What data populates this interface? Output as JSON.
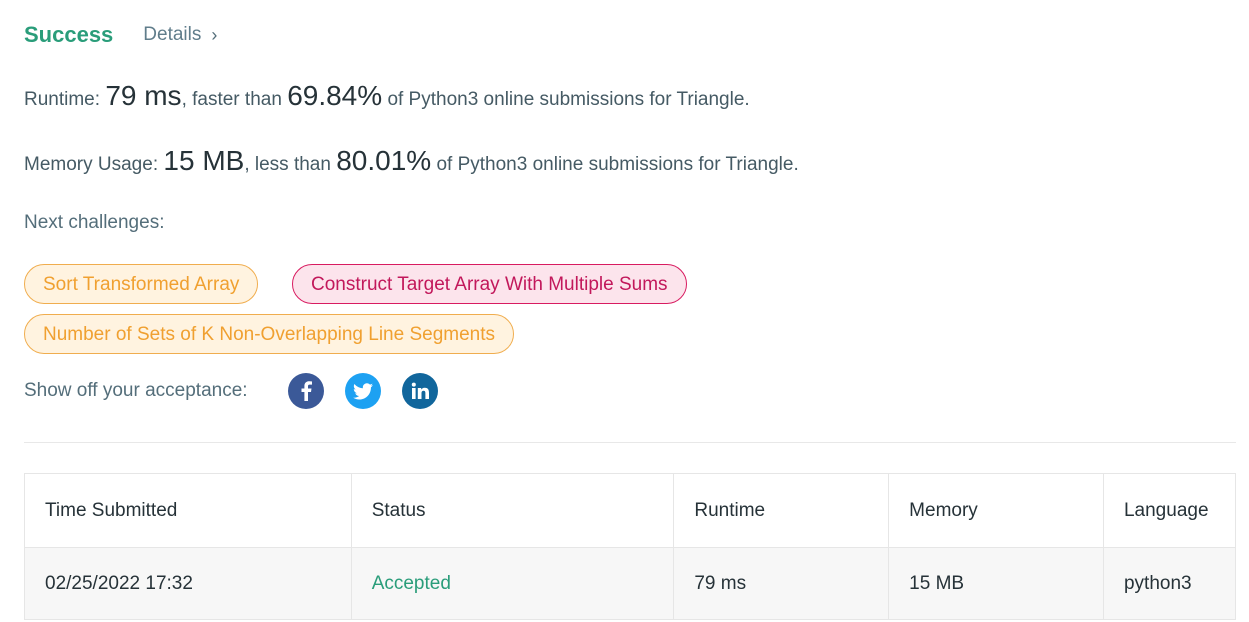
{
  "header": {
    "status": "Success",
    "details_label": "Details",
    "chevron": "›"
  },
  "runtime": {
    "label": "Runtime:",
    "value": "79 ms",
    "mid": ", faster than",
    "percent": "69.84%",
    "suffix": "of Python3 online submissions for Triangle."
  },
  "memory": {
    "label": "Memory Usage:",
    "value": "15 MB",
    "mid": ", less than",
    "percent": "80.01%",
    "suffix": "of Python3 online submissions for Triangle."
  },
  "next": {
    "title": "Next challenges:",
    "challenges": [
      {
        "label": "Sort Transformed Array",
        "difficulty": "medium"
      },
      {
        "label": "Construct Target Array With Multiple Sums",
        "difficulty": "hard"
      },
      {
        "label": "Number of Sets of K Non-Overlapping Line Segments",
        "difficulty": "medium"
      }
    ]
  },
  "share": {
    "label": "Show off your acceptance:",
    "icons": [
      "facebook-icon",
      "twitter-icon",
      "linkedin-icon"
    ]
  },
  "table": {
    "headers": [
      "Time Submitted",
      "Status",
      "Runtime",
      "Memory",
      "Language"
    ],
    "rows": [
      [
        "02/25/2022 17:32",
        "Accepted",
        "79 ms",
        "15 MB",
        "python3"
      ]
    ]
  },
  "colors": {
    "success": "#2a9d7a",
    "medium": "#f0a030",
    "hard": "#c2185b",
    "facebook": "#3b5998",
    "twitter": "#1da1f2",
    "linkedin": "#11669c"
  }
}
